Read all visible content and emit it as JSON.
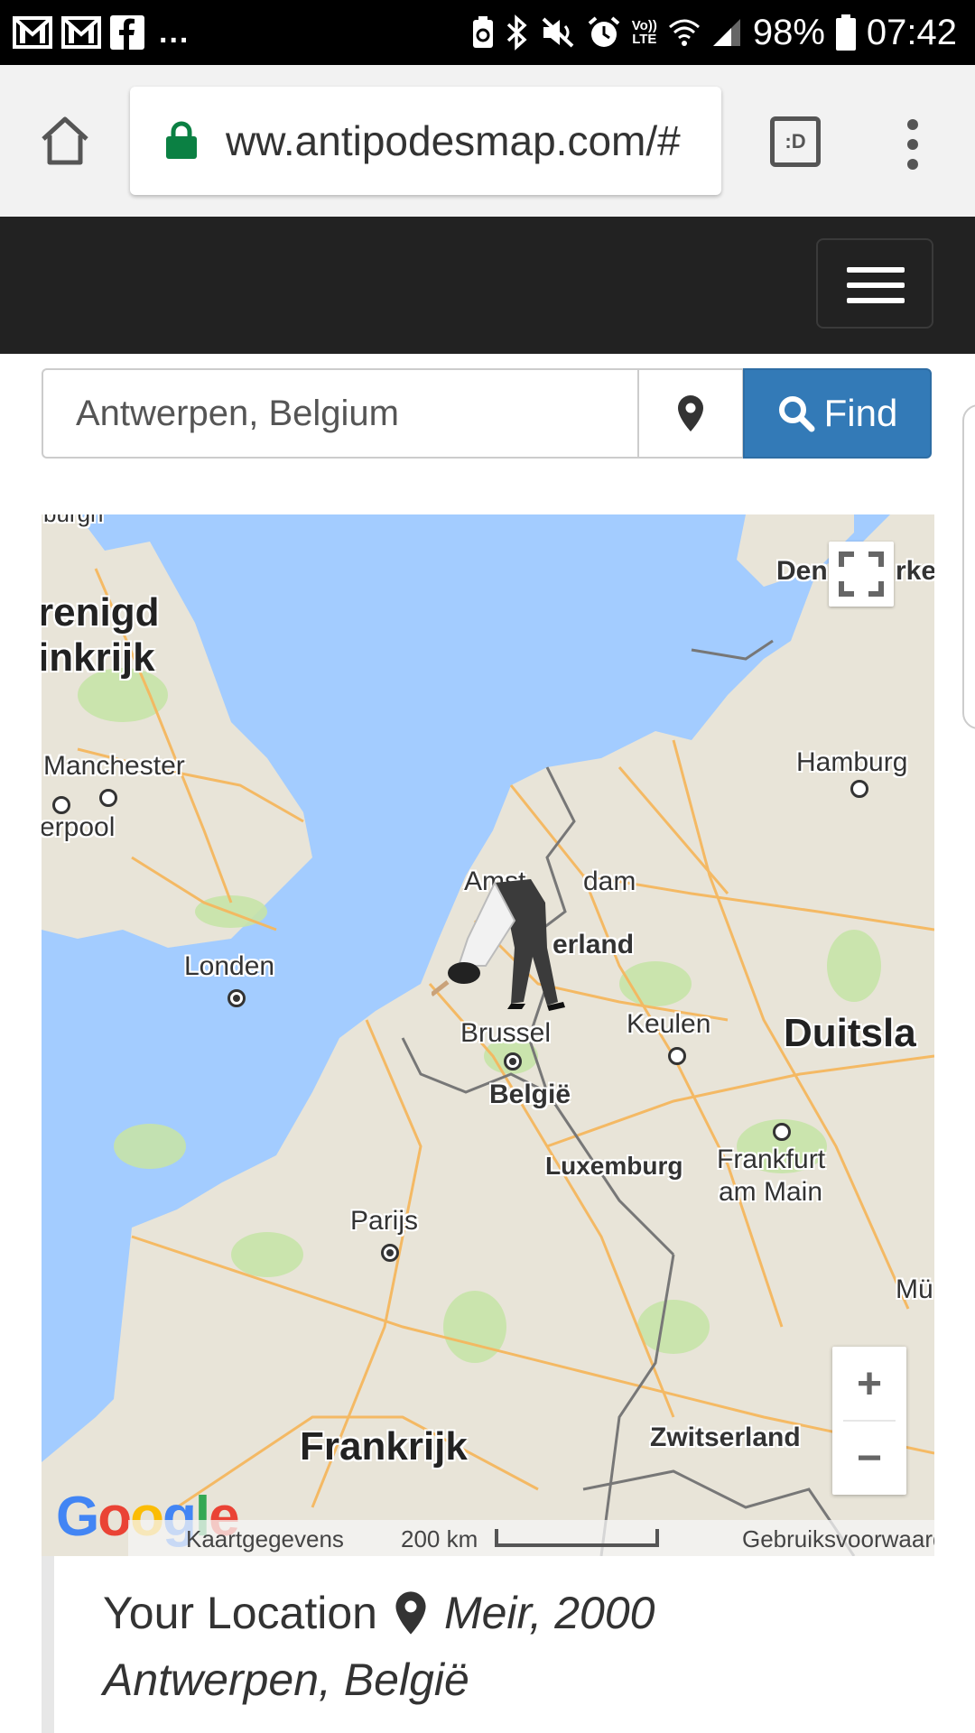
{
  "status_bar": {
    "notifications": [
      "gmail-icon",
      "gmail-icon",
      "facebook-icon"
    ],
    "overflow": "...",
    "volte": "Vo))",
    "lte": "LTE",
    "battery": "98%",
    "time": "07:42"
  },
  "browser": {
    "url": "ww.antipodesmap.com/#",
    "tab_switcher_label": ":D"
  },
  "search": {
    "value": "Antwerpen, Belgium",
    "find_label": "Find"
  },
  "map": {
    "labels": {
      "verenigd": "renigd",
      "koninkrijk": "inkrijk",
      "manchester": "Manchester",
      "liverpool": "erpool",
      "londen": "Londen",
      "amsterdam_a": "Amst",
      "amsterdam_b": "dam",
      "nederland": "erland",
      "brussel": "Brussel",
      "belgie": "België",
      "keulen": "Keulen",
      "duitsland": "Duitsla",
      "luxemburg": "Luxemburg",
      "frankfurt": "Frankfurt",
      "am_main": "am Main",
      "parijs": "Parijs",
      "frankrijk": "Frankrijk",
      "zwitserland": "Zwitserland",
      "hamburg": "Hamburg",
      "denemarken_a": "Den",
      "denemarken_b": "rke",
      "munchen": "Mü",
      "top_cut": "burgh"
    },
    "zoom_in": "+",
    "zoom_out": "−",
    "footer": {
      "map_data": "Kaartgegevens",
      "scale": "200 km",
      "terms": "Gebruiksvoorwaarden"
    },
    "logo": "Google"
  },
  "location": {
    "heading": "Your Location",
    "address_line1": "Meir, 2000",
    "address_line2": "Antwerpen, België"
  }
}
